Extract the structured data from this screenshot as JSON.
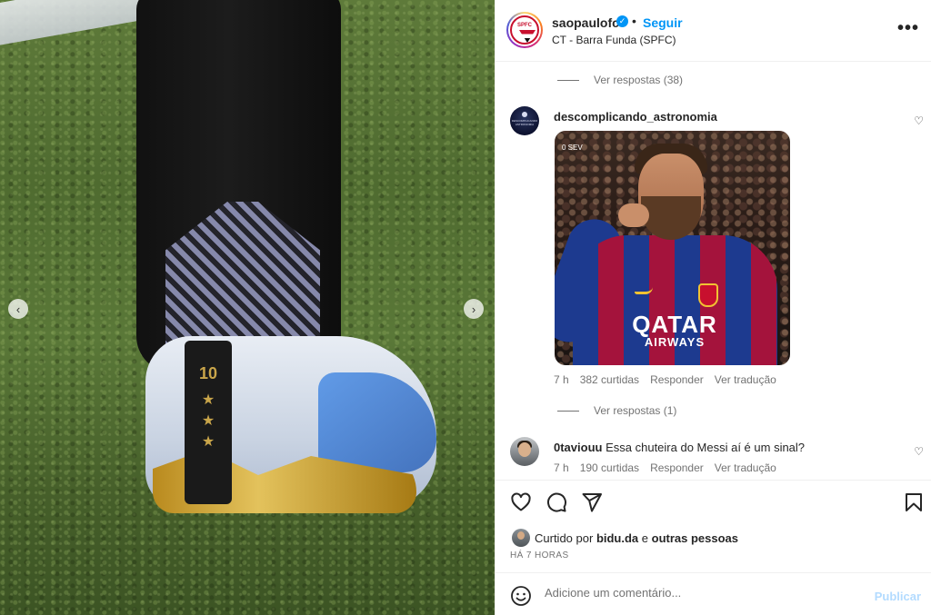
{
  "post": {
    "username": "saopaulofc",
    "follow_label": "Seguir",
    "separator": "•",
    "location": "CT - Barra Funda (SPFC)",
    "more_label": "•••",
    "avatar_text": "SPFC"
  },
  "media": {
    "jersey_number": "10",
    "stars": [
      "★",
      "★",
      "★"
    ],
    "prev_label": "‹",
    "next_label": "›"
  },
  "comments": {
    "replies_top": "Ver respostas (38)",
    "items": [
      {
        "username": "descomplicando_astronomia",
        "text": "",
        "avatar_text": "DESCOMPLICANDO ASTRONOMIA",
        "gif_overlay": "0  SEV",
        "gif_sponsor_main": "QATAR",
        "gif_sponsor_sub": "AIRWAYS",
        "time": "7 h",
        "likes": "382 curtidas",
        "reply_label": "Responder",
        "translate_label": "Ver tradução",
        "replies": "Ver respostas (1)"
      },
      {
        "username": "0taviouu",
        "text": "Essa chuteira do Messi aí é um sinal?",
        "time": "7 h",
        "likes": "190 curtidas",
        "reply_label": "Responder",
        "translate_label": "Ver tradução"
      }
    ]
  },
  "likes": {
    "prefix": "Curtido por",
    "user": "bidu.da",
    "middle": "e",
    "others": "outras pessoas"
  },
  "timestamp": "HÁ 7 HORAS",
  "add_comment": {
    "placeholder": "Adicione um comentário...",
    "publish_label": "Publicar"
  },
  "colors": {
    "accent": "#0095f6",
    "publish_disabled": "#b3dbff",
    "muted_text": "#737373",
    "text": "#262626"
  },
  "icons": [
    "verified-icon",
    "more-icon",
    "heart-icon",
    "comment-icon",
    "share-icon",
    "bookmark-icon",
    "emoji-icon",
    "chevron-left-icon",
    "chevron-right-icon"
  ]
}
